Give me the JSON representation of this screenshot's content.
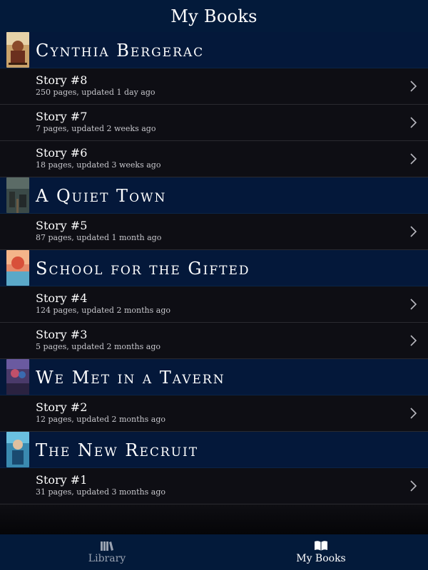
{
  "header": {
    "title": "My Books"
  },
  "books": [
    {
      "title": "Cynthia Bergerac",
      "stories": [
        {
          "title": "Story #8",
          "meta": "250 pages, updated 1 day ago"
        },
        {
          "title": "Story #7",
          "meta": "7 pages, updated 2 weeks ago"
        },
        {
          "title": "Story #6",
          "meta": "18 pages, updated 3 weeks ago"
        }
      ]
    },
    {
      "title": "A Quiet Town",
      "stories": [
        {
          "title": "Story #5",
          "meta": "87 pages, updated 1 month ago"
        }
      ]
    },
    {
      "title": "School for the Gifted",
      "stories": [
        {
          "title": "Story #4",
          "meta": "124 pages, updated 2 months ago"
        },
        {
          "title": "Story #3",
          "meta": "5 pages, updated 2 months ago"
        }
      ]
    },
    {
      "title": "We Met in a Tavern",
      "stories": [
        {
          "title": "Story #2",
          "meta": "12 pages, updated 2 months ago"
        }
      ]
    },
    {
      "title": "The New Recruit",
      "stories": [
        {
          "title": "Story #1",
          "meta": "31 pages, updated 3 months ago"
        }
      ]
    }
  ],
  "tabs": [
    {
      "label": "Library",
      "icon": "library-books-icon",
      "active": false
    },
    {
      "label": "My Books",
      "icon": "open-book-icon",
      "active": true
    }
  ],
  "colors": {
    "bar": "#031a3a",
    "section_header": "#04183a",
    "row": "#0e0e14",
    "row_divider": "#2a2a30",
    "meta_text": "#c7c7cc",
    "inactive_tab": "#9aa2b1"
  }
}
